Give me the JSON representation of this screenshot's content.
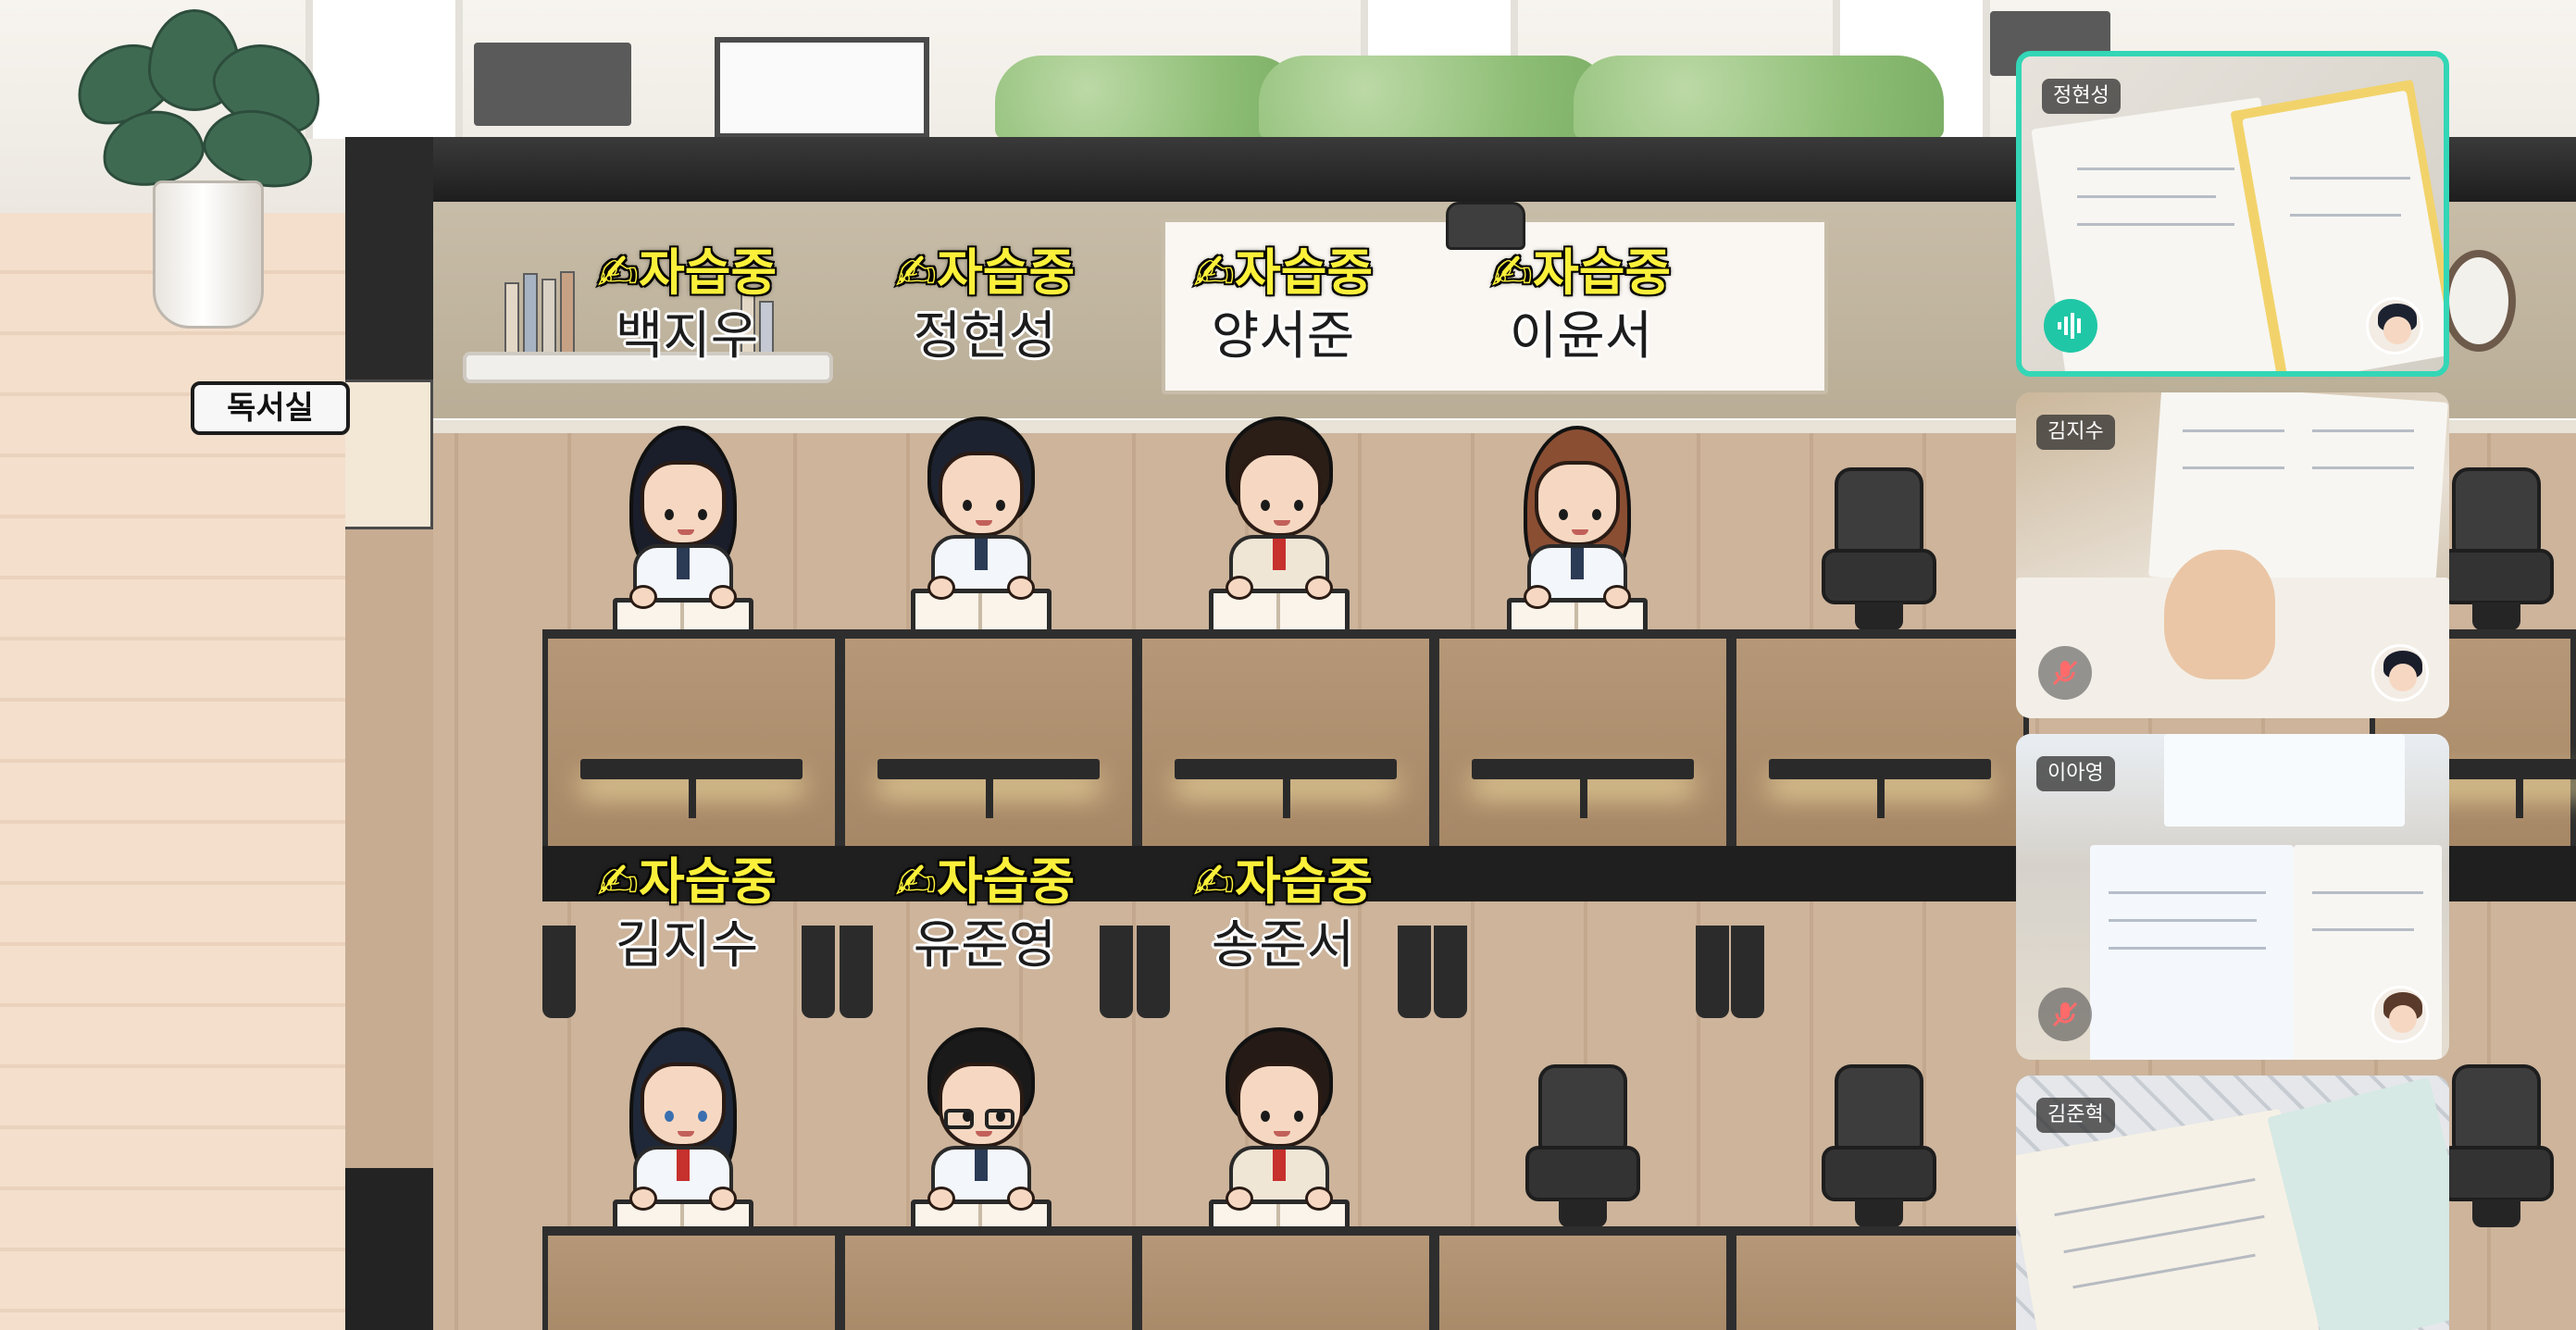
{
  "room": {
    "sign": "독서실",
    "status_text": "✍자습중"
  },
  "seats_back_row": [
    {
      "name": "백지우",
      "status": "✍자습중"
    },
    {
      "name": "정현성",
      "status": "✍자습중"
    },
    {
      "name": "양서준",
      "status": "✍자습중"
    },
    {
      "name": "이윤서",
      "status": "✍자습중"
    }
  ],
  "seats_front_row": [
    {
      "name": "김지수",
      "status": "✍자습중"
    },
    {
      "name": "유준영",
      "status": "✍자습중"
    },
    {
      "name": "송준서",
      "status": "✍자습중"
    }
  ],
  "video_tiles": [
    {
      "name": "정현성",
      "mic": "on",
      "active": true
    },
    {
      "name": "김지수",
      "mic": "off",
      "active": false
    },
    {
      "name": "이아영",
      "mic": "off",
      "active": false
    },
    {
      "name": "김준혁",
      "mic": "off",
      "active": false
    }
  ],
  "colors": {
    "status_yellow": "#fbf03a",
    "active_border": "#33d6b6",
    "mic_on": "#20c7a6"
  },
  "icons": {
    "mic_on": "audio-wave-icon",
    "mic_off": "mic-muted-icon"
  }
}
